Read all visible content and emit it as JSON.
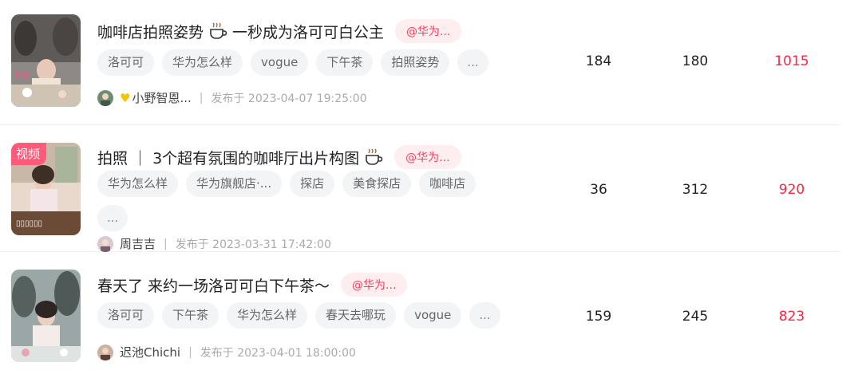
{
  "rows": [
    {
      "title": "咖啡店拍照姿势",
      "title_tail": "一秒成为洛可可白公主",
      "brand": "@华为...",
      "tags": [
        "洛可可",
        "华为怎么样",
        "vogue",
        "下午茶",
        "拍照姿势",
        "..."
      ],
      "author": "小野智恩...",
      "publish": "发布于  2023-04-07 19:25:00",
      "stats": [
        "184",
        "180",
        "1015"
      ],
      "video": false
    },
    {
      "title": "拍照 ｜ 3个超有氛围的咖啡厅出片构图",
      "title_tail": "",
      "brand": "@华为...",
      "tags": [
        "华为怎么样",
        "华为旗舰店·...",
        "探店",
        "美食探店",
        "咖啡店",
        "..."
      ],
      "author": "周吉吉",
      "publish": "发布于  2023-03-31 17:42:00",
      "stats": [
        "36",
        "312",
        "920"
      ],
      "video": true,
      "video_label": "视频"
    },
    {
      "title": "春天了 来约一场洛可可白下午茶～",
      "title_tail": "",
      "brand": "@华为...",
      "tags": [
        "洛可可",
        "下午茶",
        "华为怎么样",
        "春天去哪玩",
        "vogue",
        "..."
      ],
      "author": "迟池Chichi",
      "publish": "发布于  2023-04-01 18:00:00",
      "stats": [
        "159",
        "245",
        "823"
      ],
      "video": false
    }
  ],
  "colors": {
    "accent": "#ff2442",
    "brand_pill_bg": "#ffeef0",
    "tag_bg": "#f3f4f6"
  }
}
